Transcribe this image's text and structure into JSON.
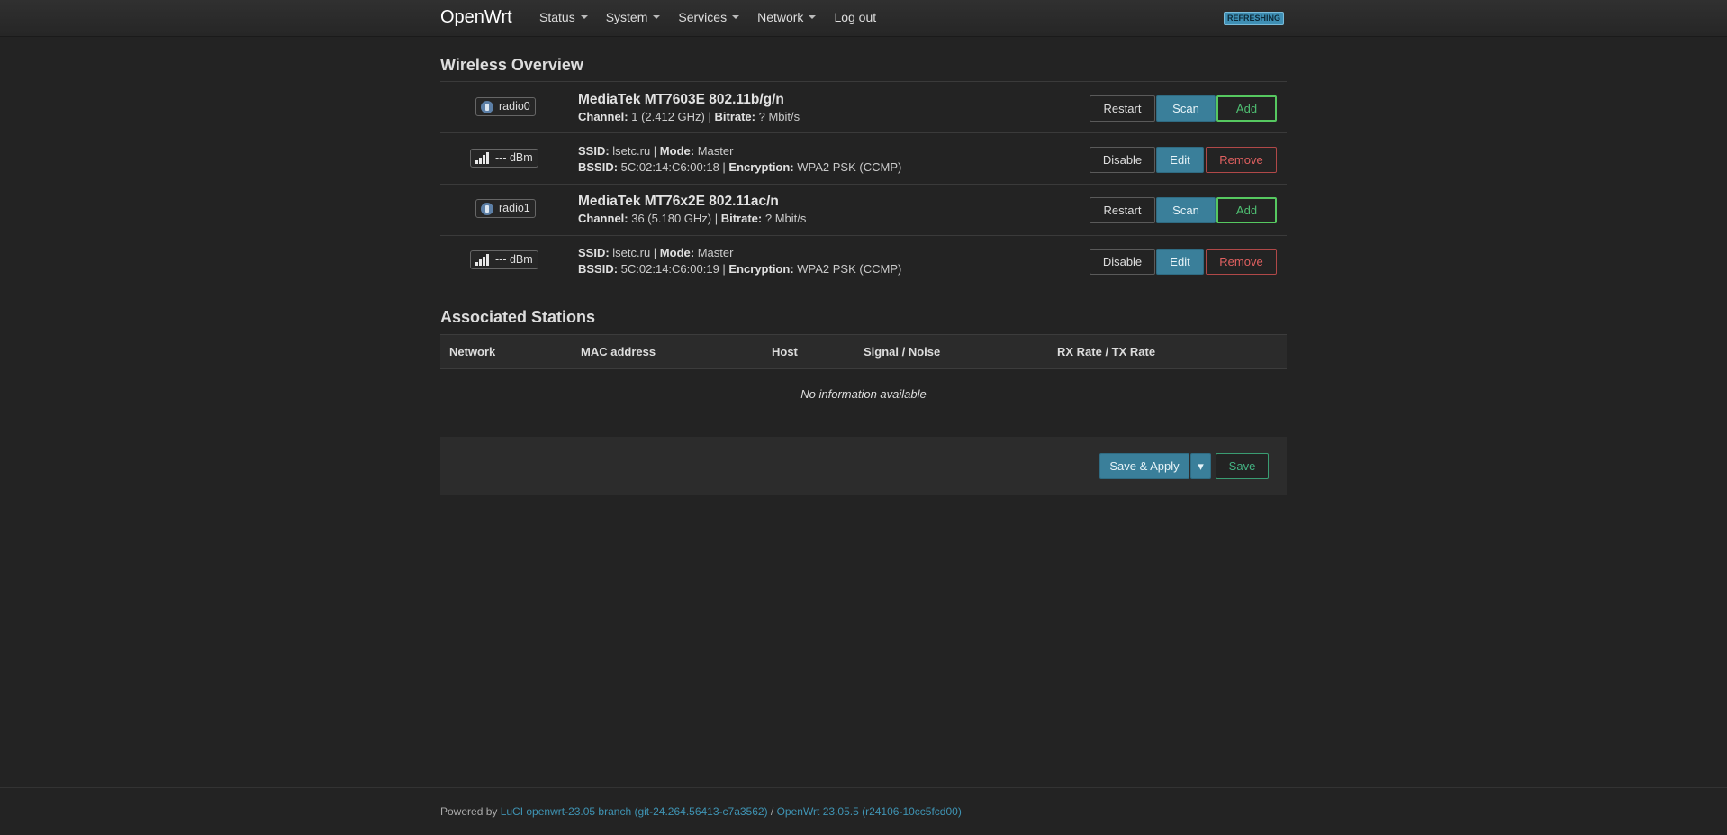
{
  "header": {
    "brand": "OpenWrt",
    "menu": [
      {
        "label": "Status"
      },
      {
        "label": "System"
      },
      {
        "label": "Services"
      },
      {
        "label": "Network"
      },
      {
        "label": "Log out"
      }
    ],
    "status_badge": "REFRESHING"
  },
  "wireless": {
    "title": "Wireless Overview",
    "rows": [
      {
        "badge": "radio0",
        "name": "MediaTek MT7603E 802.11b/g/n",
        "l1k": "Channel:",
        "l1v": " 1 (2.412 GHz) | ",
        "l1k2": "Bitrate:",
        "l1v2": " ? Mbit/s",
        "btn1": "Restart",
        "btn2": "Scan",
        "btn3": "Add"
      },
      {
        "badge": "--- dBm",
        "l1k": "SSID:",
        "l1v": " lsetc.ru | ",
        "l1k2": "Mode:",
        "l1v2": " Master",
        "l2k": "BSSID:",
        "l2v": " 5C:02:14:C6:00:18 | ",
        "l2k2": "Encryption:",
        "l2v2": " WPA2 PSK (CCMP)",
        "btn1": "Disable",
        "btn2": "Edit",
        "btn3": "Remove"
      },
      {
        "badge": "radio1",
        "name": "MediaTek MT76x2E 802.11ac/n",
        "l1k": "Channel:",
        "l1v": " 36 (5.180 GHz) | ",
        "l1k2": "Bitrate:",
        "l1v2": " ? Mbit/s",
        "btn1": "Restart",
        "btn2": "Scan",
        "btn3": "Add"
      },
      {
        "badge": "--- dBm",
        "l1k": "SSID:",
        "l1v": " lsetc.ru | ",
        "l1k2": "Mode:",
        "l1v2": " Master",
        "l2k": "BSSID:",
        "l2v": " 5C:02:14:C6:00:19 | ",
        "l2k2": "Encryption:",
        "l2v2": " WPA2 PSK (CCMP)",
        "btn1": "Disable",
        "btn2": "Edit",
        "btn3": "Remove"
      }
    ]
  },
  "stations": {
    "title": "Associated Stations",
    "columns": [
      "Network",
      "MAC address",
      "Host",
      "Signal / Noise",
      "RX Rate / TX Rate"
    ],
    "empty": "No information available"
  },
  "actions": {
    "save_apply": "Save & Apply",
    "dropdown": "▾",
    "save": "Save"
  },
  "footer": {
    "powered": "Powered by ",
    "luci_link": "LuCI openwrt-23.05 branch (git-24.264.56413-c7a3562)",
    "sep": " / ",
    "openwrt_link": "OpenWrt 23.05.5 (r24106-10cc5fcd00)"
  },
  "colors": {
    "background": "#232323",
    "primary": "#3a7f9a",
    "add": "#56c860",
    "remove": "#e06060",
    "link": "#3f94b4"
  }
}
